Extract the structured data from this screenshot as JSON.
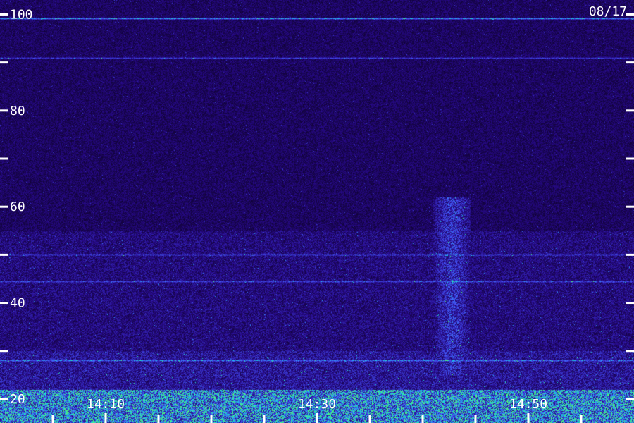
{
  "date_label": "08/17",
  "chart_data": {
    "type": "heatmap",
    "title": "",
    "xlabel": "",
    "ylabel": "",
    "y_range": [
      15,
      103
    ],
    "y_major_ticks": [
      20,
      40,
      60,
      80,
      100
    ],
    "y_minor_ticks": [
      30,
      50,
      70,
      90
    ],
    "y_tick_labels": [
      "20",
      "40",
      "60",
      "80",
      "100"
    ],
    "x_time_labels": [
      {
        "label": "14:10",
        "minute": 10
      },
      {
        "label": "14:30",
        "minute": 30
      },
      {
        "label": "14:50",
        "minute": 50
      }
    ],
    "x_range_minutes": [
      0,
      60
    ],
    "x_minor_tick_minutes": [
      5,
      15,
      20,
      25,
      35,
      40,
      45,
      55
    ],
    "colors": {
      "background_low": "#0a0020",
      "background_mid": "#3020a0",
      "bright_blue": "#4a60ff",
      "cyan": "#20d0ff",
      "green": "#40ff80",
      "tick": "#ffffff"
    },
    "intensity_bands": [
      {
        "y_from": 15,
        "y_to": 22,
        "level": 0.9
      },
      {
        "y_from": 22,
        "y_to": 30,
        "level": 0.45
      },
      {
        "y_from": 30,
        "y_to": 55,
        "level": 0.35
      },
      {
        "y_from": 55,
        "y_to": 103,
        "level": 0.25
      }
    ],
    "highlight_regions": [
      {
        "minute_from": 41,
        "minute_to": 44.5,
        "y_from": 25,
        "y_to": 62,
        "level": 0.6
      }
    ],
    "horizontal_lines": [
      {
        "y": 99.2,
        "level": 0.75
      },
      {
        "y": 91,
        "level": 0.45
      },
      {
        "y": 50,
        "level": 0.45
      },
      {
        "y": 44.5,
        "level": 0.4
      },
      {
        "y": 28,
        "level": 0.45
      }
    ]
  }
}
